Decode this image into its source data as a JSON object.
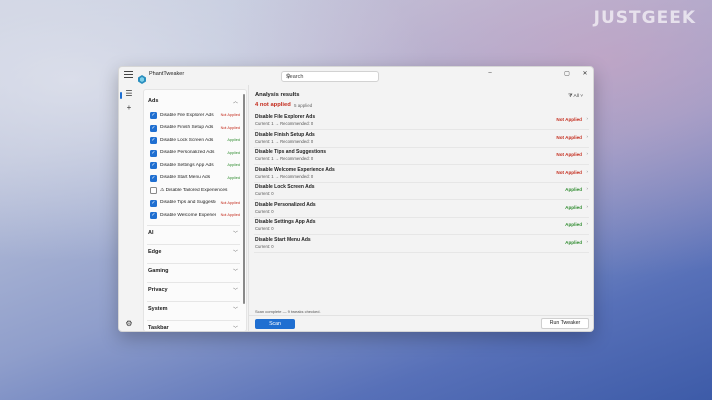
{
  "watermark": "JUSTGEEK",
  "window": {
    "title": "PhantTweaker",
    "search_placeholder": "Search",
    "icons": [
      "menu-icon",
      "search-icon",
      "filter-icon",
      "settings-icon",
      "add-icon",
      "minimize-icon",
      "maximize-icon",
      "close-icon"
    ]
  },
  "sidebar": {
    "categories": [
      {
        "label": "Ads",
        "expanded": true
      },
      {
        "label": "AI",
        "expanded": false
      },
      {
        "label": "Edge",
        "expanded": false
      },
      {
        "label": "Gaming",
        "expanded": false
      },
      {
        "label": "Privacy",
        "expanded": false
      },
      {
        "label": "System",
        "expanded": false
      },
      {
        "label": "Taskbar",
        "expanded": false
      }
    ],
    "ads_items": [
      {
        "label": "Disable File Explorer Ads",
        "checked": true,
        "status": "Not Applied"
      },
      {
        "label": "Disable Finish Setup Ads",
        "checked": true,
        "status": "Not Applied"
      },
      {
        "label": "Disable Lock Screen Ads",
        "checked": true,
        "status": "Applied"
      },
      {
        "label": "Disable Personalized Ads",
        "checked": true,
        "status": "Applied"
      },
      {
        "label": "Disable Settings App Ads",
        "checked": true,
        "status": "Applied"
      },
      {
        "label": "Disable Start Menu Ads",
        "checked": true,
        "status": "Applied"
      },
      {
        "label": "Disable Tailored Experiences",
        "checked": false,
        "status": ""
      },
      {
        "label": "Disable Tips and Suggestions",
        "checked": true,
        "status": "Not Applied"
      },
      {
        "label": "Disable Welcome Experience Ads",
        "checked": true,
        "status": "Not Applied"
      }
    ]
  },
  "main": {
    "title": "Analysis results",
    "summary_not_applied": "4 not applied",
    "summary_applied": "5 applied",
    "filter_label": "All",
    "results": [
      {
        "title": "Disable File Explorer Ads",
        "detail": "Current: 1 → Recommended: 0",
        "status": "Not Applied"
      },
      {
        "title": "Disable Finish Setup Ads",
        "detail": "Current: 1 → Recommended: 0",
        "status": "Not Applied"
      },
      {
        "title": "Disable Tips and Suggestions",
        "detail": "Current: 1 → Recommended: 0",
        "status": "Not Applied"
      },
      {
        "title": "Disable Welcome Experience Ads",
        "detail": "Current: 1 → Recommended: 0",
        "status": "Not Applied"
      },
      {
        "title": "Disable Lock Screen Ads",
        "detail": "Current: 0",
        "status": "Applied"
      },
      {
        "title": "Disable Personalized Ads",
        "detail": "Current: 0",
        "status": "Applied"
      },
      {
        "title": "Disable Settings App Ads",
        "detail": "Current: 0",
        "status": "Applied"
      },
      {
        "title": "Disable Start Menu Ads",
        "detail": "Current: 0",
        "status": "Applied"
      }
    ],
    "status_line": "Scan complete — 9 tweaks checked.",
    "scan_label": "Scan",
    "run_label": "Run Tweaker"
  },
  "colors": {
    "accent": "#1f6fd1",
    "not_applied": "#c42b1c",
    "applied": "#2e8b2e"
  }
}
